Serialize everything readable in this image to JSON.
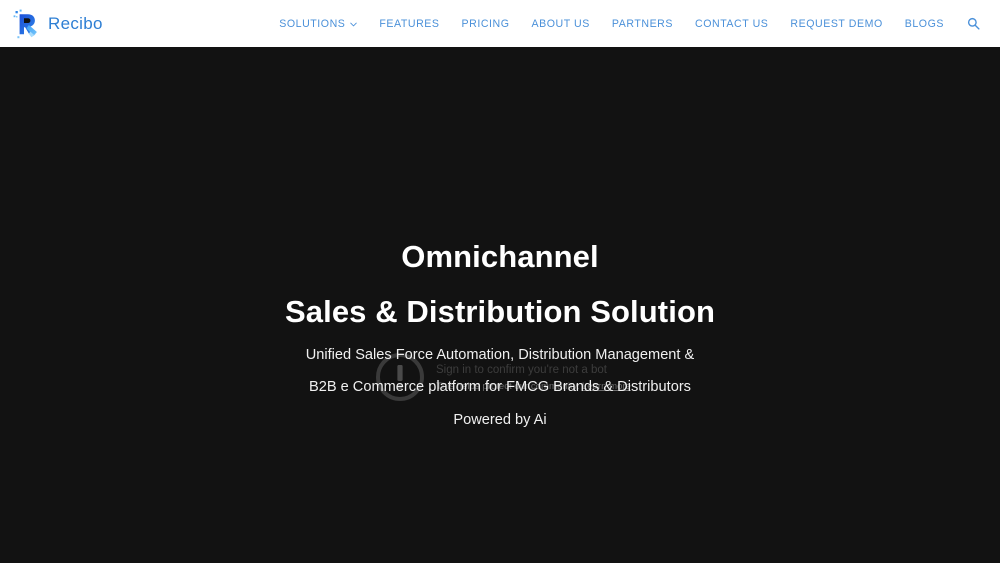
{
  "header": {
    "brand": {
      "name": "Recibo",
      "icon": "recibo-r-logo-icon",
      "color": "#2e7fd4"
    },
    "nav": [
      {
        "label": "SOLUTIONS",
        "has_dropdown": true
      },
      {
        "label": "FEATURES",
        "has_dropdown": false
      },
      {
        "label": "PRICING",
        "has_dropdown": false
      },
      {
        "label": "ABOUT US",
        "has_dropdown": false
      },
      {
        "label": "PARTNERS",
        "has_dropdown": false
      },
      {
        "label": "CONTACT US",
        "has_dropdown": false
      },
      {
        "label": "REQUEST DEMO",
        "has_dropdown": false
      },
      {
        "label": "BLOGS",
        "has_dropdown": false
      }
    ],
    "search_icon": "search-icon",
    "link_color": "#4a90d9",
    "background": "#ffffff"
  },
  "hero": {
    "title_line_1": "Omnichannel",
    "title_line_2": "Sales & Distribution Solution",
    "subtitle_line_1": "Unified Sales Force Automation, Distribution Management &",
    "subtitle_line_2": "B2B e Commerce platform for FMCG Brands & Distributors",
    "subtitle_line_3": "Powered by Ai",
    "background": "#121212",
    "text_color": "#ffffff"
  },
  "blocked_media": {
    "icon": "exclamation-circle-icon",
    "headline": "Sign in to confirm you're not a bot",
    "sub_text": "This helps protect our community.",
    "link_label": "Learn more"
  }
}
